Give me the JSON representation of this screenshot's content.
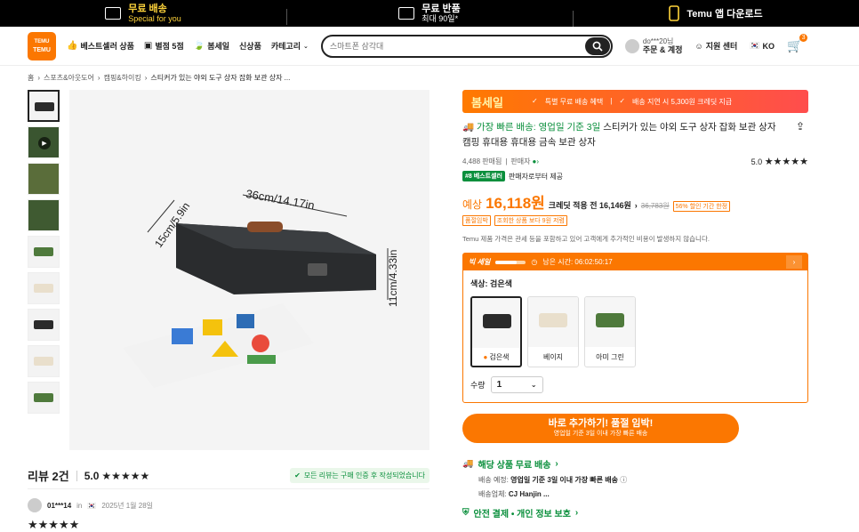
{
  "promo": {
    "free_shipping_title": "무료 배송",
    "free_shipping_sub": "Special for you",
    "free_return_title": "무료 반품",
    "free_return_sub": "최대 90일*",
    "app_download": "Temu 앱 다운로드"
  },
  "header": {
    "logo_top": "TEMU",
    "logo_bottom": "TEMU",
    "nav": [
      {
        "label": "베스트셀러 상품",
        "icon": "thumbs-up-icon"
      },
      {
        "label": "별점 5점",
        "icon": "star-box-icon"
      },
      {
        "label": "봄세일",
        "icon": "leaf-icon"
      },
      {
        "label": "신상품"
      },
      {
        "label": "카테고리"
      }
    ],
    "search_placeholder": "스마트폰 삼각대",
    "account_line1": "do***20님",
    "account_line2": "주문 & 계정",
    "support": "지원 센터",
    "language": "KO",
    "cart_count": "3"
  },
  "breadcrumb": [
    "홈",
    "스포츠&아웃도어",
    "캠핑&하이킹",
    "스티커가 있는 야외 도구 상자 잡화 보관 상자 ..."
  ],
  "product": {
    "image_labels": {
      "width": "36cm/14.17in",
      "depth": "15cm/5.9in",
      "height": "11cm/4.33in"
    },
    "sale_title": "봄세일",
    "sale_perk1": "특별 무료 배송 혜택",
    "sale_perk2": "배송 지연 시 5,300원 크레딧 지급",
    "ship_prefix": "가장 빠른 배송: 영업일 기준 3일",
    "title": "스티커가 있는 야외 도구 상자 잡화 보관 상자 캠핑 휴대용 휴대용 금속 보관 상자",
    "sold": "4,488 판매됨",
    "seller": "판매자",
    "rating": "5.0",
    "stars": "★★★★★",
    "best_badge": "#8 베스트셀러",
    "best_text": "판매자로부터 제공",
    "price_label": "예상",
    "price": "16,118원",
    "credit_text": "크레딧 적용 전 16,146원",
    "old_price": "36,783원",
    "discount_tag": "56% 할인 기간 한정",
    "tag_almost": "품절임박",
    "tag_compare": "조회한 상품 보다 9원 저렴",
    "notice": "Temu 제품 가격은 관세 등을 포함하고 있어 고객에게 추가적인 비용이 발생하지 않습니다.",
    "deal_label": "빅 세일",
    "deal_progress": 0.7,
    "deal_timer": "남은 시간: 06:02:50:17",
    "color_label": "색상: 검은색",
    "colors": [
      {
        "name": "검은색",
        "hex": "#2b2b2b"
      },
      {
        "name": "베이지",
        "hex": "#e9dfcc"
      },
      {
        "name": "아미 그린",
        "hex": "#4f7a3c"
      }
    ],
    "qty_label": "수량",
    "qty_value": "1",
    "cta_main": "바로 추가하기! 품절 임박!",
    "cta_sub": "영업일 기준 3일 이내 가장 빠른 배송",
    "ship_head": "해당 상품 무료 배송",
    "ship_eta_label": "배송 예정:",
    "ship_eta": "영업일 기준 3일 이내 가장 빠른 배송",
    "carriers_label": "배송업체:",
    "carriers": "CJ   Hanjin ...",
    "secure": "안전 결제 • 개인 정보 보호"
  },
  "reviews": {
    "title": "리뷰 2건",
    "score": "5.0",
    "stars": "★★★★★",
    "badge": "모든 리뷰는 구매 인증 후 작성되었습니다",
    "user": "01***14",
    "in": "in",
    "date": "2025년 1월 28일",
    "user_stars": "★★★★★"
  },
  "colors": {
    "accent": "#fb7701",
    "green": "#0a8f3c",
    "sale_gradient_end": "#ff4d4d"
  }
}
